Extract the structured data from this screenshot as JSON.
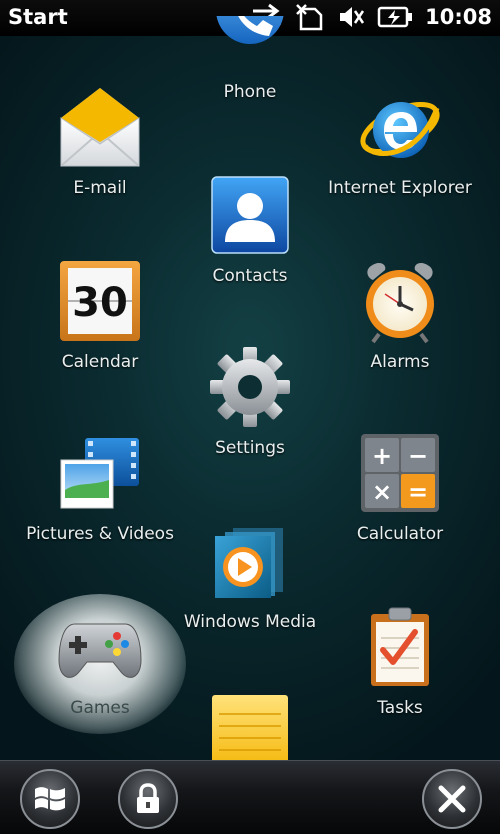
{
  "status_bar": {
    "title": "Start",
    "time": "10:08",
    "icons": [
      "data-sync-icon",
      "no-sim-icon",
      "volume-off-icon",
      "battery-charging-icon"
    ]
  },
  "apps": [
    {
      "id": "phone",
      "label": "Phone",
      "icon": "phone-icon"
    },
    {
      "id": "email",
      "label": "E-mail",
      "icon": "envelope-icon"
    },
    {
      "id": "ie",
      "label": "Internet Explorer",
      "icon": "internet-explorer-icon"
    },
    {
      "id": "contacts",
      "label": "Contacts",
      "icon": "contact-card-icon"
    },
    {
      "id": "calendar",
      "label": "Calendar",
      "icon": "calendar-icon",
      "day": "30"
    },
    {
      "id": "alarms",
      "label": "Alarms",
      "icon": "alarm-clock-icon"
    },
    {
      "id": "settings",
      "label": "Settings",
      "icon": "gear-icon"
    },
    {
      "id": "pictures",
      "label": "Pictures & Videos",
      "icon": "pictures-videos-icon"
    },
    {
      "id": "calculator",
      "label": "Calculator",
      "icon": "calculator-icon",
      "keys": [
        "+",
        "−",
        "×",
        "="
      ]
    },
    {
      "id": "media",
      "label": "Windows Media",
      "icon": "media-player-icon"
    },
    {
      "id": "games",
      "label": "Games",
      "icon": "gamepad-icon",
      "selected": true
    },
    {
      "id": "tasks",
      "label": "Tasks",
      "icon": "task-checklist-icon"
    },
    {
      "id": "notes",
      "label": "",
      "icon": "notes-icon"
    }
  ],
  "bottom_bar": {
    "start_icon": "windows-logo-icon",
    "lock_icon": "lock-icon",
    "close_icon": "close-icon"
  },
  "colors": {
    "background": "#0a2a2f",
    "status_bar": "#000000",
    "accent_blue": "#1e88e5",
    "accent_orange": "#f39a1e"
  }
}
